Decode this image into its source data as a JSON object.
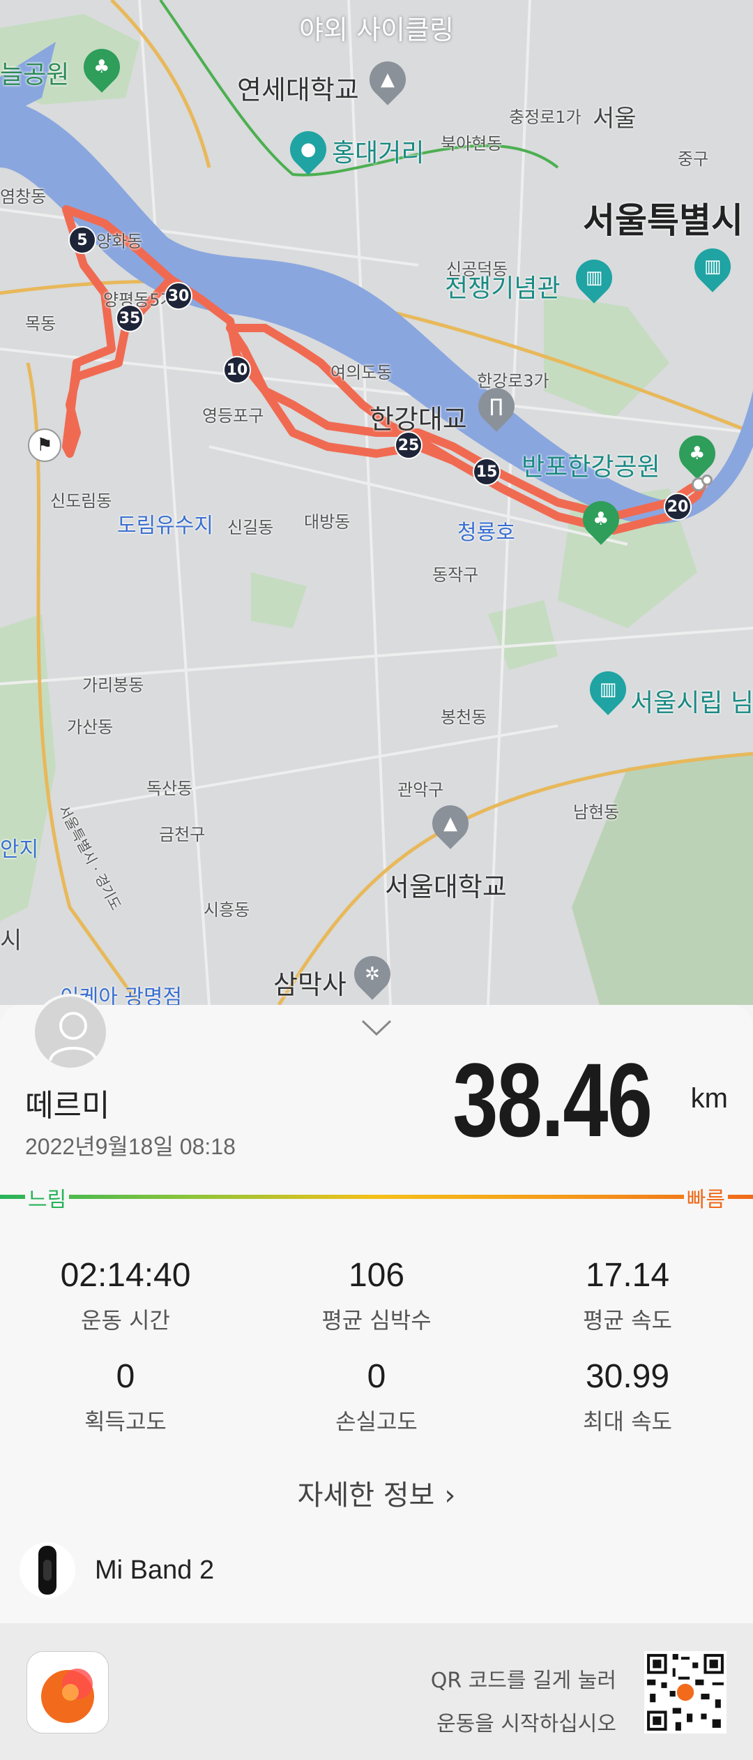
{
  "map": {
    "title": "야외 사이클링",
    "labels": {
      "seoul": "서울",
      "seoul_city": "서울특별시",
      "yonsei": "연세대학교",
      "hongdae": "홍대거리",
      "war_memorial": "전쟁기념관",
      "banpo_park": "반포한강공원",
      "hangang_bridge": "한강대교",
      "seoul_museum": "서울시립 님",
      "snu": "서울대학교",
      "samaksa": "삼막사",
      "ikea": "이케아 광명점",
      "dorim": "도림유수지",
      "cheongryongho": "청룡호",
      "chungjeongro": "충정로1가",
      "bukahyeon": "북아현동",
      "junggu": "중구",
      "singongdeok": "신공덕동",
      "hangangro": "한강로3가",
      "yeomchang": "염창동",
      "yanghwa": "양화동",
      "yangpyeong": "양평동5가",
      "mok": "목동",
      "yeouido": "여의도동",
      "yeongdeungpo": "영등포구",
      "sindorim": "신도림동",
      "singil": "신길동",
      "daebang": "대방동",
      "dongjak": "동작구",
      "garibong": "가리봉동",
      "gasan": "가산동",
      "bongcheon": "봉천동",
      "doksan": "독산동",
      "geumcheon": "금천구",
      "gwanak": "관악구",
      "namhyeon": "남현동",
      "siheung": "시흥동",
      "seoul_gyeonggi": "서울특별시 · 경기도",
      "neul_park": "늘공원",
      "si": "시",
      "anji": "안지"
    },
    "km_markers": [
      "5",
      "30",
      "35",
      "10",
      "25",
      "15",
      "20"
    ]
  },
  "activity": {
    "username": "떼르미",
    "datetime": "2022년9월18일 08:18",
    "distance": "38.46",
    "unit": "km",
    "speed_slow": "느림",
    "speed_fast": "빠름"
  },
  "stats": [
    {
      "value": "02:14:40",
      "label": "운동 시간"
    },
    {
      "value": "106",
      "label": "평균 심박수"
    },
    {
      "value": "17.14",
      "label": "평균 속도"
    },
    {
      "value": "0",
      "label": "획득고도"
    },
    {
      "value": "0",
      "label": "손실고도"
    },
    {
      "value": "30.99",
      "label": "최대 속도"
    }
  ],
  "more_info": "자세한 정보",
  "device": "Mi Band 2",
  "footer": {
    "qr_line1": "QR 코드를 길게 눌러",
    "qr_line2": "운동을 시작하십시오"
  },
  "colors": {
    "route": "#f06a52",
    "river": "#8aa6df",
    "slow": "#27b35a",
    "fast": "#f06a1a",
    "marker": "#1f2538"
  }
}
